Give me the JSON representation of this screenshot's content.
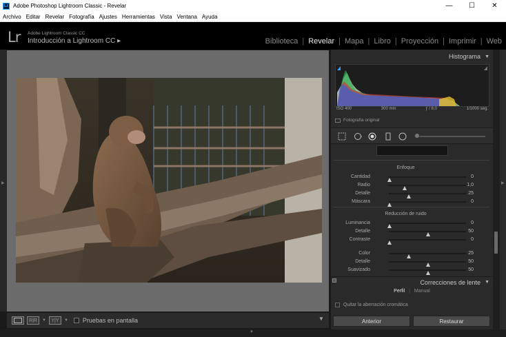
{
  "window": {
    "title": "Adobe Photoshop Lightroom Classic - Revelar",
    "app_icon": "Lr",
    "controls": {
      "minimize": "—",
      "maximize": "☐",
      "close": "✕"
    }
  },
  "menu": [
    "Archivo",
    "Editar",
    "Revelar",
    "Fotografía",
    "Ajustes",
    "Herramientas",
    "Vista",
    "Ventana",
    "Ayuda"
  ],
  "identity": {
    "logo": "Lr",
    "product": "Adobe Lightroom Classic CC",
    "catalog": "Introducción a Lightroom CC  ▸"
  },
  "modules": [
    {
      "label": "Biblioteca",
      "active": false
    },
    {
      "label": "Revelar",
      "active": true
    },
    {
      "label": "Mapa",
      "active": false
    },
    {
      "label": "Libro",
      "active": false
    },
    {
      "label": "Proyección",
      "active": false
    },
    {
      "label": "Imprimir",
      "active": false
    },
    {
      "label": "Web",
      "active": false
    }
  ],
  "toolbar": {
    "loupe_icon": "loupe-view-icon",
    "before_after_label": "R|R",
    "yy_label": "Y|Y",
    "softproof_label": "Pruebas en pantalla"
  },
  "histogram": {
    "title": "Histograma",
    "iso": "ISO 400",
    "focal": "300 mm",
    "aperture": "ƒ / 8,0",
    "shutter": "1/1000 seg.",
    "original_photo": "Fotografía original"
  },
  "sharpening": {
    "title": "Enfoque",
    "sliders": [
      {
        "label": "Cantidad",
        "value": "0",
        "position": 0.0
      },
      {
        "label": "Radio",
        "value": "1,0",
        "position": 0.2
      },
      {
        "label": "Detalle",
        "value": "25",
        "position": 0.25
      },
      {
        "label": "Máscara",
        "value": "0",
        "position": 0.0
      }
    ]
  },
  "noise_reduction": {
    "title": "Reducción de ruido",
    "sliders": [
      {
        "label": "Luminancia",
        "value": "0",
        "position": 0.0
      },
      {
        "label": "Detalle",
        "value": "50",
        "position": 0.5
      },
      {
        "label": "Contraste",
        "value": "0",
        "position": 0.0
      },
      {
        "label": "Color",
        "value": "25",
        "position": 0.25
      },
      {
        "label": "Detalle",
        "value": "50",
        "position": 0.5
      },
      {
        "label": "Suavizado",
        "value": "50",
        "position": 0.5
      }
    ]
  },
  "lens": {
    "title": "Correcciones de lente",
    "tabs": [
      {
        "label": "Perfil",
        "active": true
      },
      {
        "label": "Manual",
        "active": false
      }
    ],
    "option": "Quitar la aberración cromática"
  },
  "buttons": {
    "previous": "Anterior",
    "reset": "Restaurar"
  },
  "colors": {
    "accent": "#e8e8e8",
    "panel": "#2a2a2a",
    "background": "#6c6c6c"
  }
}
